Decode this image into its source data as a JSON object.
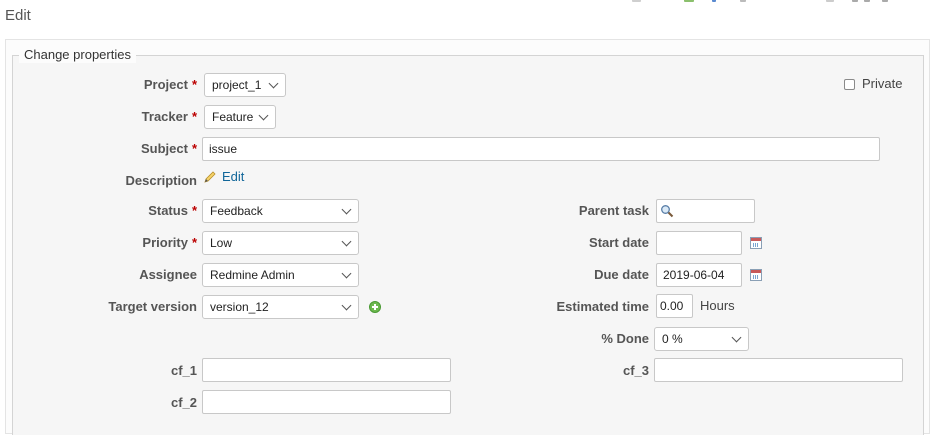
{
  "page": {
    "title": "Edit"
  },
  "fieldset": {
    "legend": "Change properties"
  },
  "required_marker": "*",
  "fields": {
    "project": {
      "label": "Project",
      "value": "project_1"
    },
    "private": {
      "label": "Private",
      "checked": false
    },
    "tracker": {
      "label": "Tracker",
      "value": "Feature"
    },
    "subject": {
      "label": "Subject",
      "value": "issue"
    },
    "description": {
      "label": "Description",
      "edit_link": "Edit"
    },
    "status": {
      "label": "Status",
      "value": "Feedback"
    },
    "priority": {
      "label": "Priority",
      "value": "Low"
    },
    "assignee": {
      "label": "Assignee",
      "value": "Redmine Admin"
    },
    "target_version": {
      "label": "Target version",
      "value": "version_12"
    },
    "parent_task": {
      "label": "Parent task",
      "value": ""
    },
    "start_date": {
      "label": "Start date",
      "value": ""
    },
    "due_date": {
      "label": "Due date",
      "value": "2019-06-04"
    },
    "estimated_time": {
      "label": "Estimated time",
      "value": "0.00",
      "unit": "Hours"
    },
    "done_ratio": {
      "label": "% Done",
      "value": "0 %"
    },
    "cf_1": {
      "label": "cf_1",
      "value": ""
    },
    "cf_2": {
      "label": "cf_2",
      "value": ""
    },
    "cf_3": {
      "label": "cf_3",
      "value": ""
    }
  },
  "icons": {
    "description_edit": "pencil-icon",
    "parent_task_search": "search-icon",
    "calendar": "calendar-icon",
    "add_version": "add-icon"
  },
  "colors": {
    "required": "#bb0000",
    "link": "#116699",
    "add_icon": "#6cb84e"
  }
}
